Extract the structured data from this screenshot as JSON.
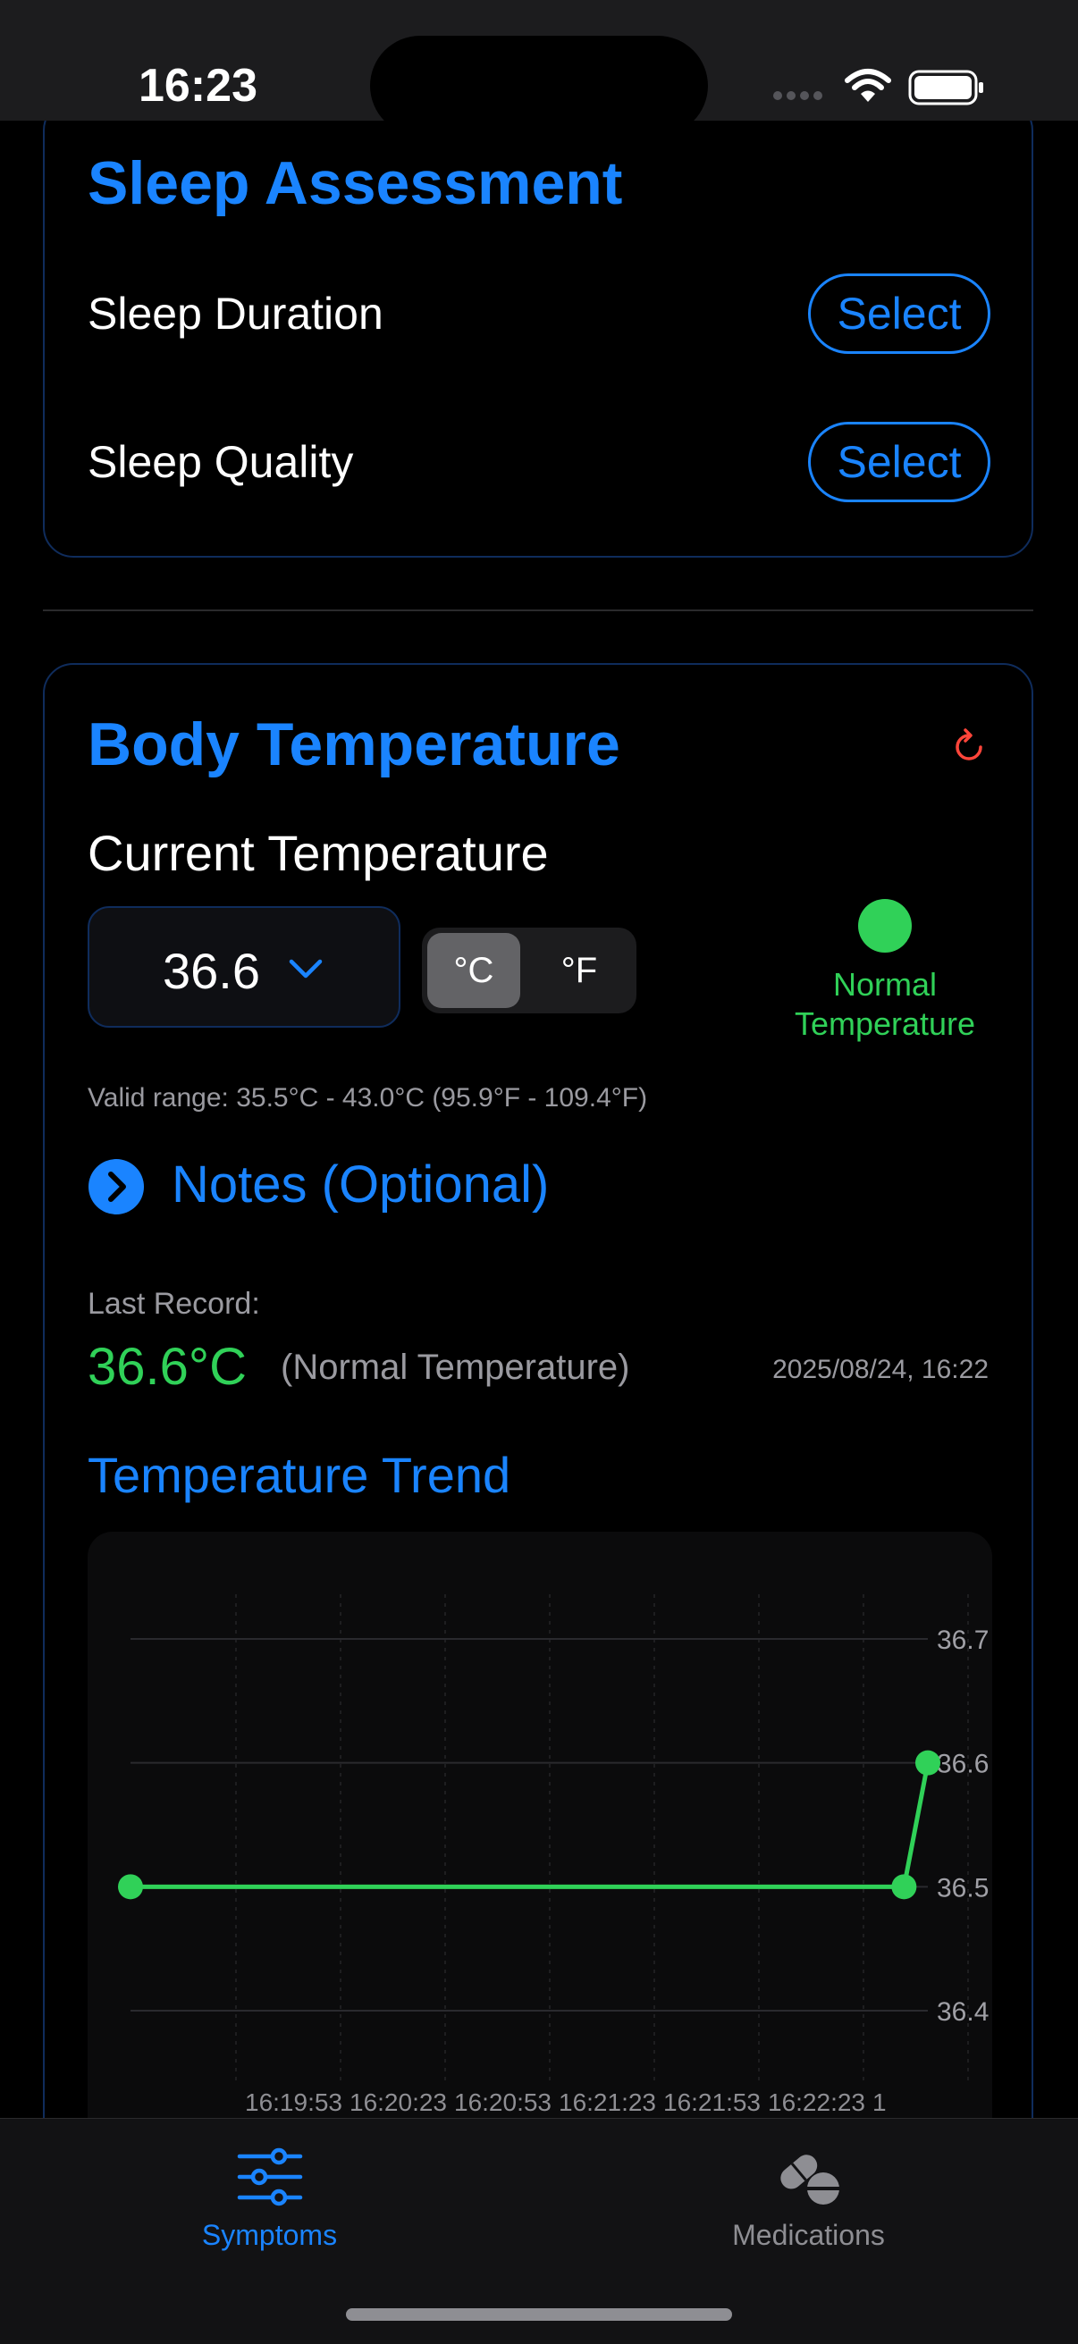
{
  "status_bar": {
    "time": "16:23"
  },
  "sleep_assessment": {
    "title": "Sleep Assessment",
    "rows": [
      {
        "label": "Sleep Duration",
        "button": "Select"
      },
      {
        "label": "Sleep Quality",
        "button": "Select"
      }
    ]
  },
  "body_temperature": {
    "title": "Body Temperature",
    "current_label": "Current Temperature",
    "current_value": "36.6",
    "units": {
      "celsius": "°C",
      "fahrenheit": "°F",
      "selected": "°C"
    },
    "status_text": "Normal Temperature",
    "status_color": "#30d158",
    "valid_range": "Valid range: 35.5°C - 43.0°C (95.9°F - 109.4°F)",
    "notes_label": "Notes (Optional)",
    "last_record": {
      "label": "Last Record:",
      "value": "36.6°C",
      "status": "(Normal Temperature)",
      "datetime": "2025/08/24, 16:22"
    },
    "trend_title": "Temperature Trend"
  },
  "chart_data": {
    "type": "line",
    "x_tick_labels": [
      "16:19:53",
      "16:20:23",
      "16:20:53",
      "16:21:23",
      "16:21:53",
      "16:22:23",
      "1"
    ],
    "y_tick_labels": [
      "36.7",
      "36.6",
      "36.5",
      "36.4"
    ],
    "ylim": [
      36.4,
      36.7
    ],
    "grid": true,
    "series": [
      {
        "color": "#30d158",
        "points": [
          {
            "x": "16:19:23",
            "y": 36.5
          },
          {
            "x": "16:22:38",
            "y": 36.5
          },
          {
            "x": "16:22:44",
            "y": 36.6
          }
        ]
      }
    ]
  },
  "tabs": [
    {
      "label": "Symptoms",
      "icon": "sliders-icon",
      "active": true
    },
    {
      "label": "Medications",
      "icon": "pills-icon",
      "active": false
    }
  ],
  "colors": {
    "accent": "#1a84ff",
    "success": "#30d158",
    "alert": "#ff453a"
  }
}
